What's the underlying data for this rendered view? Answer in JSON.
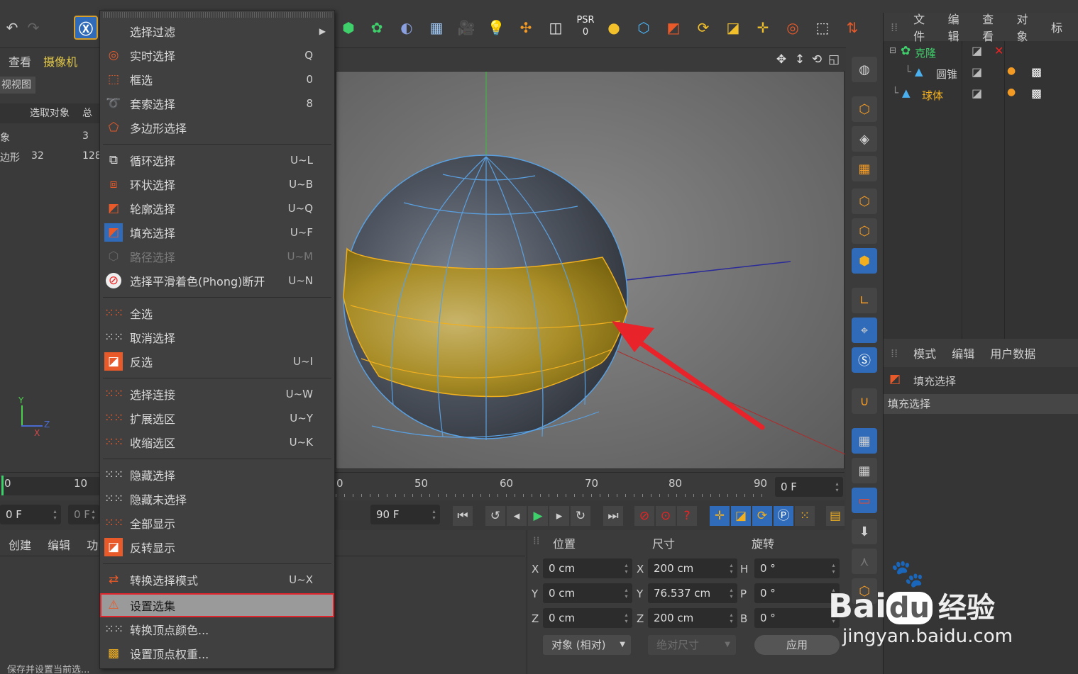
{
  "toolbar": {
    "psr_label": "PSR",
    "psr_value": "0",
    "xyz_label": "X Y Z"
  },
  "left_panel": {
    "tabs": [
      "查看",
      "摄像机"
    ],
    "view_label": "视视图",
    "col_headers": [
      "选取对象",
      "总"
    ],
    "rows": [
      {
        "label": "象",
        "value": "3"
      },
      {
        "label": "边形",
        "value": "32",
        "value2": "128"
      }
    ],
    "axis_y": "Y",
    "axis_z": "Z",
    "axis_x": "X"
  },
  "menu": {
    "items": [
      {
        "label": "选择过滤",
        "shortcut": "",
        "has_sub": true
      },
      {
        "label": "实时选择",
        "shortcut": "Q"
      },
      {
        "label": "框选",
        "shortcut": "0"
      },
      {
        "label": "套索选择",
        "shortcut": "8"
      },
      {
        "label": "多边形选择",
        "shortcut": ""
      },
      {
        "label": "循环选择",
        "shortcut": "U~L"
      },
      {
        "label": "环状选择",
        "shortcut": "U~B"
      },
      {
        "label": "轮廓选择",
        "shortcut": "U~Q"
      },
      {
        "label": "填充选择",
        "shortcut": "U~F"
      },
      {
        "label": "路径选择",
        "shortcut": "U~M",
        "disabled": true
      },
      {
        "label": "选择平滑着色(Phong)断开",
        "shortcut": "U~N"
      },
      {
        "label": "全选",
        "shortcut": ""
      },
      {
        "label": "取消选择",
        "shortcut": ""
      },
      {
        "label": "反选",
        "shortcut": "U~I"
      },
      {
        "label": "选择连接",
        "shortcut": "U~W"
      },
      {
        "label": "扩展选区",
        "shortcut": "U~Y"
      },
      {
        "label": "收缩选区",
        "shortcut": "U~K"
      },
      {
        "label": "隐藏选择",
        "shortcut": ""
      },
      {
        "label": "隐藏未选择",
        "shortcut": ""
      },
      {
        "label": "全部显示",
        "shortcut": ""
      },
      {
        "label": "反转显示",
        "shortcut": ""
      },
      {
        "label": "转换选择模式",
        "shortcut": "U~X"
      },
      {
        "label": "设置选集",
        "shortcut": "",
        "highlighted": true
      },
      {
        "label": "转换顶点颜色...",
        "shortcut": ""
      },
      {
        "label": "设置顶点权重...",
        "shortcut": ""
      }
    ]
  },
  "object_manager": {
    "menu": [
      "文件",
      "编辑",
      "查看",
      "对象",
      "标"
    ],
    "objects": [
      {
        "name": "克隆"
      },
      {
        "name": "圆锥"
      },
      {
        "name": "球体"
      }
    ]
  },
  "attribute_manager": {
    "menu": [
      "模式",
      "编辑",
      "用户数据"
    ],
    "tag_title": "填充选择",
    "tag_subtitle": "填充选择"
  },
  "timeline": {
    "ticks": [
      "0",
      "10",
      "0",
      "50",
      "60",
      "70",
      "80",
      "90"
    ],
    "frame_display": "0 F",
    "start_field": "0 F",
    "start_field2": "0 F",
    "end_field": "90 F"
  },
  "bottom_left": {
    "tabs": [
      "创建",
      "编辑",
      "功"
    ],
    "status": "保存并设置当前选..."
  },
  "coords": {
    "headers": [
      "位置",
      "尺寸",
      "旋转"
    ],
    "rows": [
      {
        "axis": "X",
        "pos": "0 cm",
        "size_axis": "X",
        "size": "200 cm",
        "rot_axis": "H",
        "rot": "0 °"
      },
      {
        "axis": "Y",
        "pos": "0 cm",
        "size_axis": "Y",
        "size": "76.537 cm",
        "rot_axis": "P",
        "rot": "0 °"
      },
      {
        "axis": "Z",
        "pos": "0 cm",
        "size_axis": "Z",
        "size": "200 cm",
        "rot_axis": "B",
        "rot": "0 °"
      }
    ],
    "mode_select": "对象 (相对)",
    "size_select": "绝对尺寸",
    "apply_button": "应用"
  },
  "watermark": {
    "brand": "Bai",
    "brand2": "du",
    "brand3": "经验",
    "url": "jingyan.baidu.com"
  },
  "colors": {
    "accent_blue": "#2f6bb8",
    "selection_yellow": "#b8900e",
    "highlight_red": "#e0262c",
    "arrow_red": "#e8242a"
  }
}
